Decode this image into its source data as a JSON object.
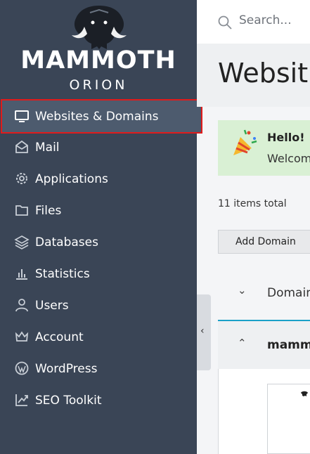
{
  "brand": {
    "name": "MAMMOTH",
    "sub": "ORION"
  },
  "sidebar": {
    "items": [
      {
        "label": "Websites & Domains",
        "icon": "monitor-icon",
        "active": true
      },
      {
        "label": "Mail",
        "icon": "mail-icon"
      },
      {
        "label": "Applications",
        "icon": "gear-icon"
      },
      {
        "label": "Files",
        "icon": "folder-icon"
      },
      {
        "label": "Databases",
        "icon": "layers-icon"
      },
      {
        "label": "Statistics",
        "icon": "bar-chart-icon"
      },
      {
        "label": "Users",
        "icon": "user-icon"
      },
      {
        "label": "Account",
        "icon": "crown-icon"
      },
      {
        "label": "WordPress",
        "icon": "wordpress-icon"
      },
      {
        "label": "SEO Toolkit",
        "icon": "trend-icon"
      }
    ]
  },
  "search": {
    "placeholder": "Search..."
  },
  "main": {
    "title": "Websit",
    "hello_title": "Hello!",
    "hello_text": "Welcom",
    "items_total": "11 items total",
    "add_domain": "Add Domain",
    "column_domain": "Domain",
    "row_domain": "mamm"
  },
  "colors": {
    "sidebar_bg": "#3a4556",
    "active_bg": "#4d5b6e",
    "highlight": "#e01b1b",
    "hello_bg": "#d9f0d4",
    "accent": "#1aa0c8"
  }
}
